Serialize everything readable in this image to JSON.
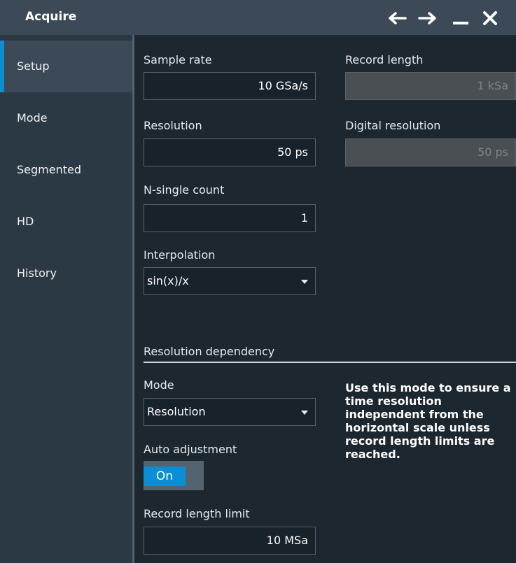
{
  "window": {
    "title": "Acquire"
  },
  "sidebar": {
    "items": [
      {
        "label": "Setup",
        "active": true
      },
      {
        "label": "Mode"
      },
      {
        "label": "Segmented"
      },
      {
        "label": "HD"
      },
      {
        "label": "History"
      }
    ]
  },
  "setup": {
    "sample_rate": {
      "label": "Sample rate",
      "value": "10 GSa/s"
    },
    "record_length": {
      "label": "Record length",
      "value": "1 kSa"
    },
    "resolution": {
      "label": "Resolution",
      "value": "50 ps"
    },
    "digital_resolution": {
      "label": "Digital resolution",
      "value": "50 ps"
    },
    "n_single_count": {
      "label": "N-single count",
      "value": "1"
    },
    "interpolation": {
      "label": "Interpolation",
      "value": "sin(x)/x"
    }
  },
  "resolution_dependency": {
    "section_title": "Resolution dependency",
    "mode": {
      "label": "Mode",
      "value": "Resolution"
    },
    "auto_adjustment": {
      "label": "Auto adjustment",
      "state": "On"
    },
    "record_length_limit": {
      "label": "Record length limit",
      "value": "10 MSa"
    },
    "help_text": "Use this mode to ensure a time resolution independent from the horizontal scale unless record length limits are reached."
  },
  "colors": {
    "accent": "#0a8fd6",
    "titlebar": "#3b4a56",
    "sidebar": "#2b3945",
    "background": "#1c2730"
  }
}
